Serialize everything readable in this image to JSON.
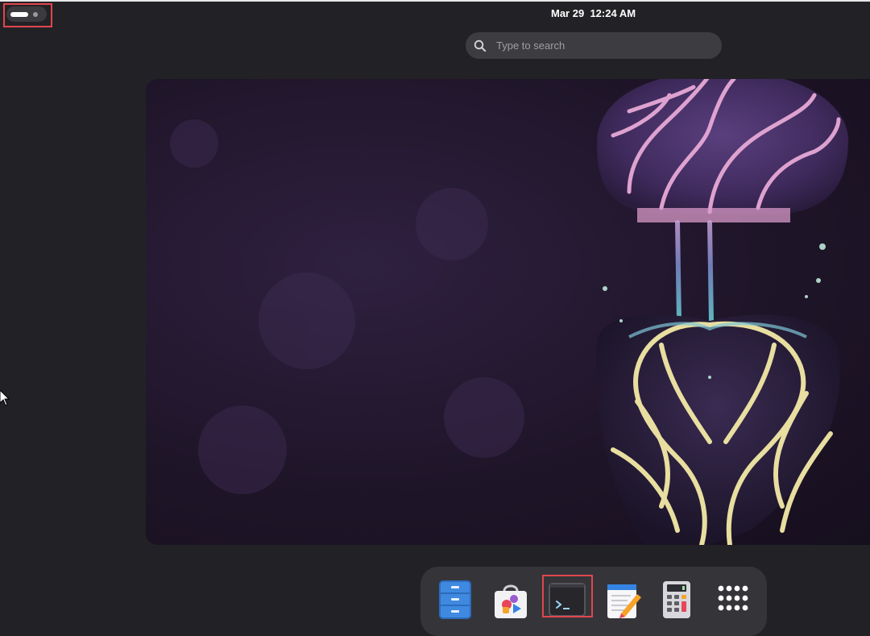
{
  "topbar": {
    "date": "Mar 29",
    "time": "12:24 AM"
  },
  "search": {
    "placeholder": "Type to search",
    "icon": "search-icon"
  },
  "dock": {
    "items": [
      {
        "name": "Files",
        "icon": "files-icon"
      },
      {
        "name": "Software",
        "icon": "software-store-icon"
      },
      {
        "name": "Terminal",
        "icon": "terminal-icon"
      },
      {
        "name": "Text Editor",
        "icon": "text-editor-icon"
      },
      {
        "name": "Calculator",
        "icon": "calculator-icon"
      },
      {
        "name": "Show Applications",
        "icon": "app-grid-icon"
      }
    ]
  },
  "colors": {
    "background": "#222226",
    "dock": "#353539",
    "highlight": "#e0464e",
    "wallpaper": "#1f1529"
  }
}
